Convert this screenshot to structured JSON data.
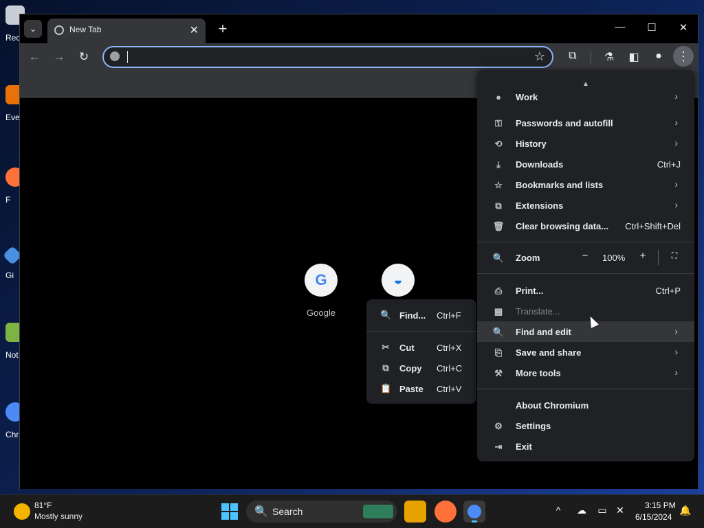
{
  "desktop": {
    "icons": [
      {
        "label": "Rec"
      },
      {
        "label": "Eve"
      },
      {
        "label": "F"
      },
      {
        "label": "Gi"
      },
      {
        "label": "Not"
      },
      {
        "label": "Chr"
      }
    ]
  },
  "browser": {
    "tab_search_icon": "chevron-down",
    "tab": {
      "title": "New Tab",
      "close": "✕"
    },
    "new_tab": "+",
    "window_controls": {
      "minimize": "—",
      "maximize": "☐",
      "close": "✕"
    },
    "toolbar": {
      "back": "←",
      "forward": "→",
      "reload": "↻",
      "omnibox_value": "",
      "star": "☆",
      "menu": "⋮"
    },
    "ntp": {
      "tiles": [
        {
          "name": "Google",
          "letter": "G"
        },
        {
          "name": "",
          "letter": "◒"
        }
      ]
    }
  },
  "find_submenu": {
    "items": [
      {
        "label": "Find...",
        "shortcut": "Ctrl+F",
        "icon": "🔍"
      },
      {
        "label": "Cut",
        "shortcut": "Ctrl+X",
        "icon": "✂"
      },
      {
        "label": "Copy",
        "shortcut": "Ctrl+C",
        "icon": "⧉"
      },
      {
        "label": "Paste",
        "shortcut": "Ctrl+V",
        "icon": "📋"
      }
    ]
  },
  "menu": {
    "scroll_up": "▲",
    "profile": {
      "label": "Work"
    },
    "items_top": [
      {
        "label": "Passwords and autofill",
        "shortcut": "",
        "icon": "⚿",
        "arrow": "›"
      },
      {
        "label": "History",
        "shortcut": "",
        "icon": "⟲",
        "arrow": "›"
      },
      {
        "label": "Downloads",
        "shortcut": "Ctrl+J",
        "icon": "⤓",
        "arrow": ""
      },
      {
        "label": "Bookmarks and lists",
        "shortcut": "",
        "icon": "☆",
        "arrow": "›"
      },
      {
        "label": "Extensions",
        "shortcut": "",
        "icon": "⧉",
        "arrow": "›"
      },
      {
        "label": "Clear browsing data...",
        "shortcut": "Ctrl+Shift+Del",
        "icon": "🗑",
        "arrow": ""
      }
    ],
    "zoom": {
      "label": "Zoom",
      "minus": "−",
      "value": "100%",
      "plus": "+",
      "fullscreen": "⛶",
      "icon": "🔍"
    },
    "items_mid": [
      {
        "label": "Print...",
        "shortcut": "Ctrl+P",
        "icon": "⎙",
        "arrow": ""
      },
      {
        "label": "Translate...",
        "shortcut": "",
        "icon": "▦",
        "arrow": ""
      },
      {
        "label": "Find and edit",
        "shortcut": "",
        "icon": "🔍",
        "arrow": "›"
      },
      {
        "label": "Save and share",
        "shortcut": "",
        "icon": "⎘",
        "arrow": "›"
      },
      {
        "label": "More tools",
        "shortcut": "",
        "icon": "⚒",
        "arrow": "›"
      }
    ],
    "items_bottom": [
      {
        "label": "About Chromium",
        "icon": ""
      },
      {
        "label": "Settings",
        "icon": "⚙"
      },
      {
        "label": "Exit",
        "icon": "⇥"
      }
    ]
  },
  "taskbar": {
    "weather": {
      "temp": "81°F",
      "desc": "Mostly sunny"
    },
    "search": {
      "label": "Search",
      "icon": "🔍"
    },
    "tray": {
      "chevron": "^"
    },
    "clock": {
      "time": "3:15 PM",
      "date": "6/15/2024"
    }
  }
}
